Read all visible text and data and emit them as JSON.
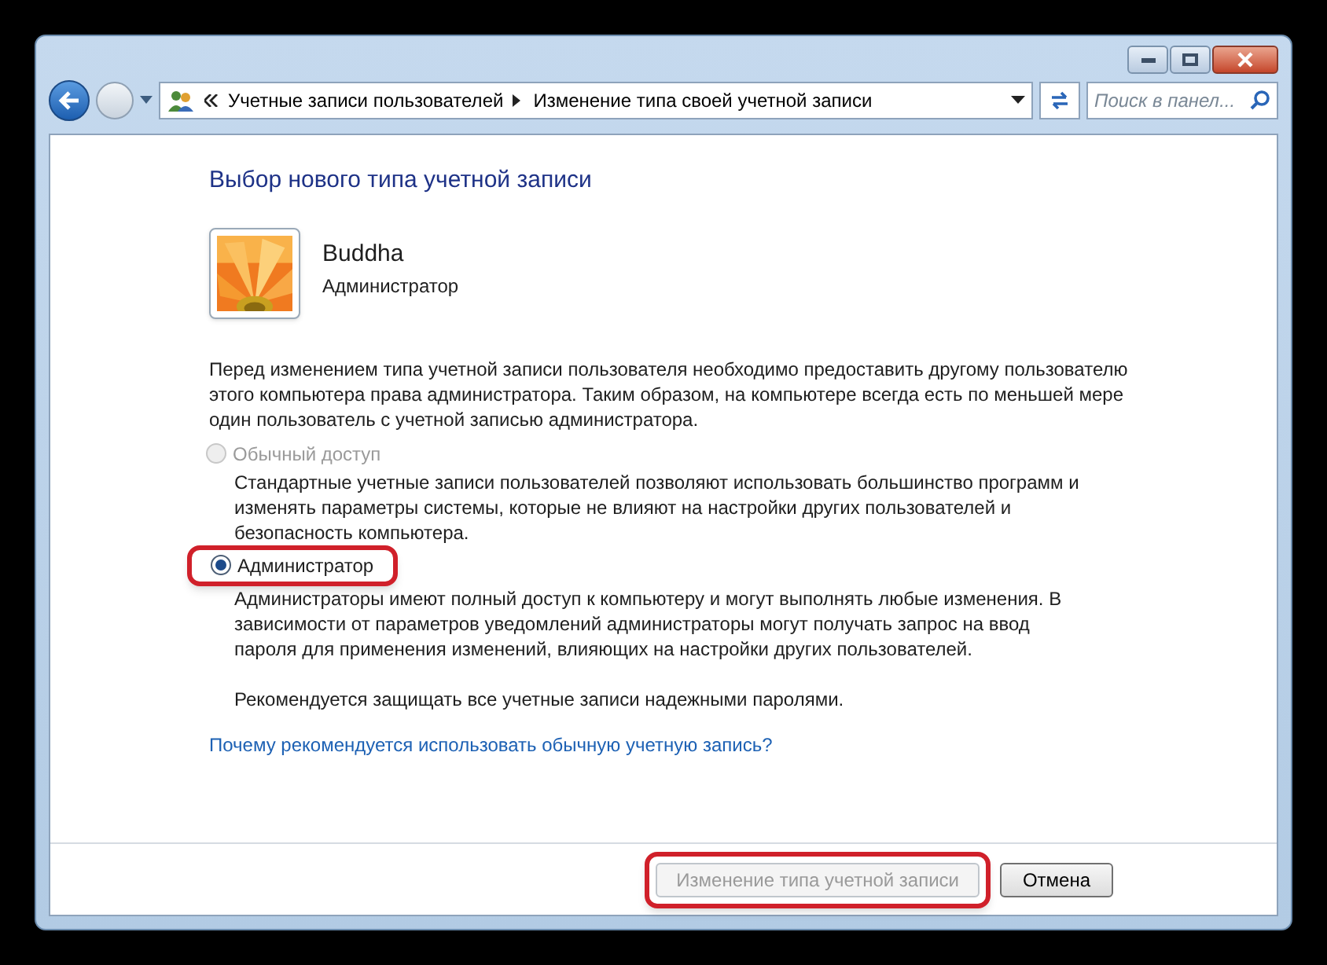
{
  "address_bar": {
    "breadcrumbs": [
      "Учетные записи пользователей",
      "Изменение типа своей учетной записи"
    ]
  },
  "search": {
    "placeholder": "Поиск в панел..."
  },
  "heading": "Выбор нового типа учетной записи",
  "user": {
    "name": "Buddha",
    "role": "Администратор"
  },
  "intro": "Перед изменением типа учетной записи пользователя необходимо предоставить другому пользователю этого компьютера права администратора. Таким образом, на компьютере всегда есть по меньшей мере один пользователь с учетной записью администратора.",
  "options": [
    {
      "label": "Обычный доступ",
      "selected": false,
      "disabled": true,
      "highlighted": false,
      "description": [
        "Стандартные учетные записи пользователей позволяют использовать большинство программ и изменять параметры системы, которые не влияют на настройки других пользователей и безопасность компьютера."
      ]
    },
    {
      "label": "Администратор",
      "selected": true,
      "disabled": false,
      "highlighted": true,
      "description": [
        "Администраторы имеют полный доступ к компьютеру и могут выполнять любые изменения. В зависимости от параметров уведомлений администраторы могут получать запрос на ввод пароля для применения изменений, влияющих на настройки других пользователей.",
        "Рекомендуется защищать все учетные записи надежными паролями."
      ]
    }
  ],
  "help_link": "Почему рекомендуется использовать обычную учетную запись?",
  "buttons": [
    {
      "label": "Изменение типа учетной записи",
      "disabled": true,
      "highlighted": true
    },
    {
      "label": "Отмена",
      "disabled": false,
      "highlighted": false
    }
  ]
}
